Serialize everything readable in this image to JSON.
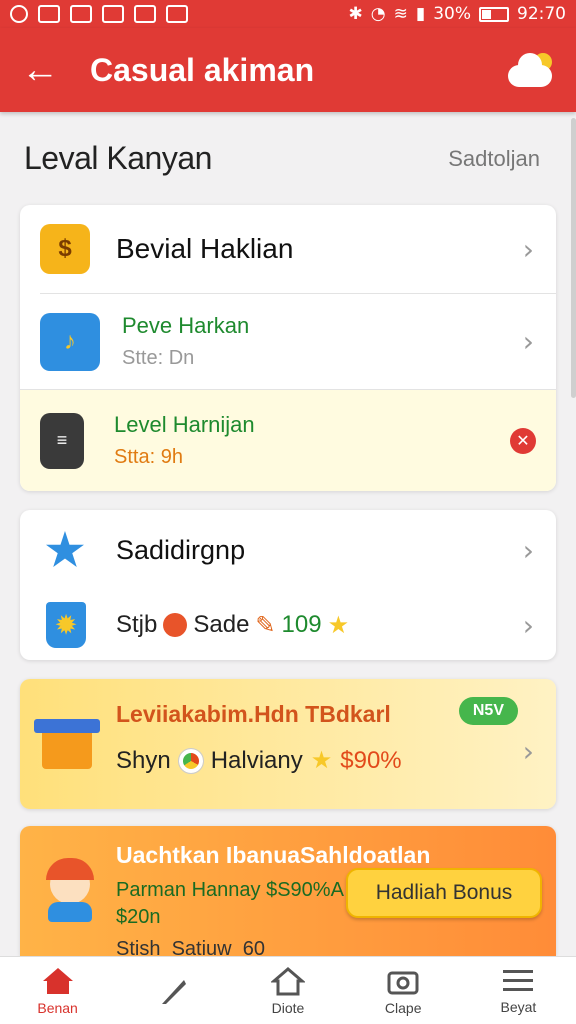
{
  "status": {
    "battery": "30%",
    "time": "92:70"
  },
  "app_bar": {
    "title": "Casual akiman"
  },
  "section": {
    "title": "Leval Kanyan",
    "link": "Sadtoljan"
  },
  "card1": {
    "row1": {
      "title": "Bevial Haklian"
    },
    "row2": {
      "title": "Peve Harkan",
      "subtitle": "Stte: Dn"
    },
    "row3": {
      "title": "Level Harnijan",
      "subtitle": "Stta: 9h"
    }
  },
  "card2": {
    "row1": {
      "title": "Sadidirgnp"
    },
    "row2": {
      "part1": "Stjb",
      "part2": "Sade",
      "part3": "109"
    }
  },
  "promo1": {
    "title": "Leviiakabim.Hdn TBdkarl",
    "badge": "N5V",
    "line_a": "Shyn",
    "line_b": "Halviany",
    "line_c": "$90%"
  },
  "promo2": {
    "title": "Uachtkan IbanuaSahldoatlan",
    "line1": "Parman Hannay $S90%A",
    "line2": "$20n",
    "button": "Hadliah Bonus",
    "peek": "Stish  Satiuw  60"
  },
  "nav": [
    {
      "label": "Benan"
    },
    {
      "label": ""
    },
    {
      "label": "Diote"
    },
    {
      "label": "Clape"
    },
    {
      "label": "Beyat"
    }
  ]
}
